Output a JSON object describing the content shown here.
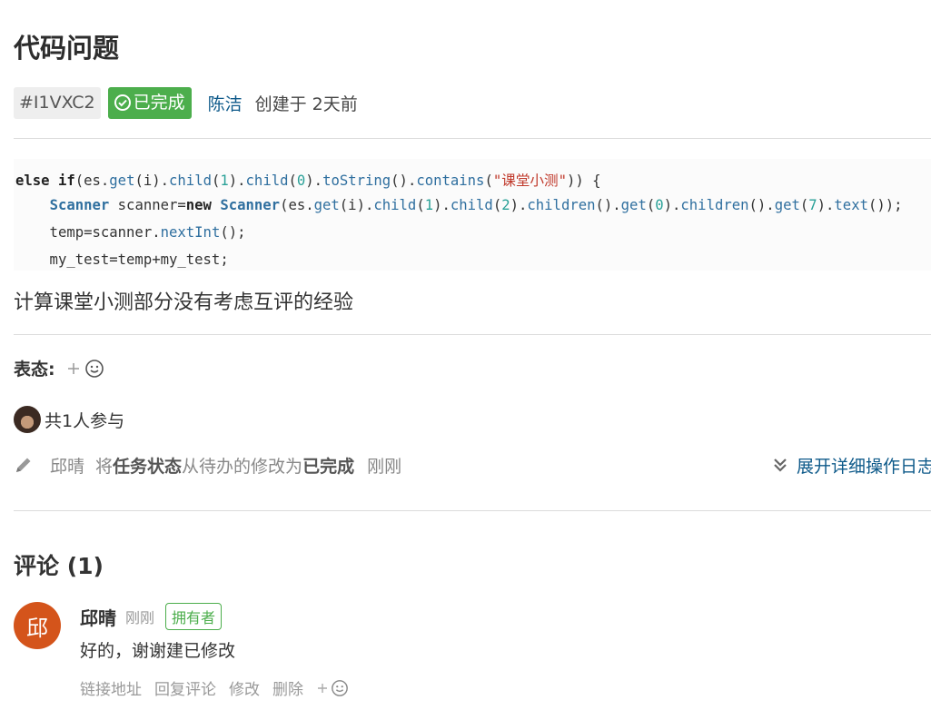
{
  "issue": {
    "title": "代码问题",
    "id": "#I1VXC2",
    "status": "已完成",
    "author": "陈洁",
    "created_label": "创建于",
    "created_time": "2天前"
  },
  "code_lines": [
    "else if(es.get(i).child(1).child(0).toString().contains(\"课堂小测\")) {",
    "    Scanner scanner=new Scanner(es.get(i).child(1).child(2).children().get(0).children().get(7).text());",
    "    temp=scanner.nextInt();",
    "    my_test=temp+my_test;"
  ],
  "description": "计算课堂小测部分没有考虑互评的经验",
  "reactions": {
    "label": "表态:",
    "add_icon": "add-emoji-icon"
  },
  "participants": {
    "text": "共1人参与"
  },
  "activity": {
    "actor": "邱晴",
    "prefix": "将",
    "field": "任务状态",
    "from_text": "从待办的修改为",
    "to_status": "已完成",
    "time": "刚刚",
    "expand_label": "展开详细操作日志"
  },
  "comments": {
    "title": "评论 (1)",
    "items": [
      {
        "avatar_char": "邱",
        "author": "邱晴",
        "time": "刚刚",
        "badge": "拥有者",
        "body": "好的，谢谢建已修改",
        "actions": [
          "链接地址",
          "回复评论",
          "修改",
          "删除"
        ]
      }
    ]
  },
  "colors": {
    "status_green": "#4cae4c",
    "link_blue": "#0e5a8a",
    "comment_avatar": "#d4541b"
  }
}
